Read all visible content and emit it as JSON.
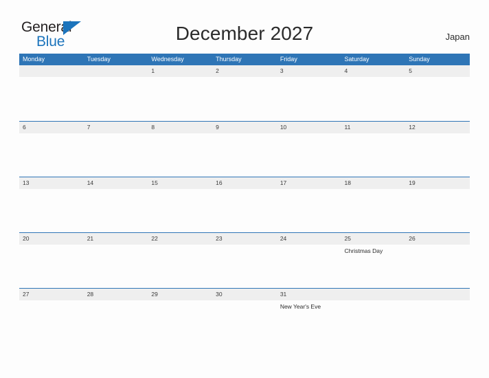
{
  "brand": {
    "name_part1": "General",
    "name_part2": "Blue",
    "flag_color": "#1c74bc"
  },
  "header": {
    "title": "December 2027",
    "locale": "Japan"
  },
  "calendar": {
    "accent_color": "#2e75b6",
    "band_color": "#efefef",
    "weekdays": [
      "Monday",
      "Tuesday",
      "Wednesday",
      "Thursday",
      "Friday",
      "Saturday",
      "Sunday"
    ],
    "weeks": [
      {
        "days": [
          {
            "num": "",
            "event": ""
          },
          {
            "num": "",
            "event": ""
          },
          {
            "num": "1",
            "event": ""
          },
          {
            "num": "2",
            "event": ""
          },
          {
            "num": "3",
            "event": ""
          },
          {
            "num": "4",
            "event": ""
          },
          {
            "num": "5",
            "event": ""
          }
        ]
      },
      {
        "days": [
          {
            "num": "6",
            "event": ""
          },
          {
            "num": "7",
            "event": ""
          },
          {
            "num": "8",
            "event": ""
          },
          {
            "num": "9",
            "event": ""
          },
          {
            "num": "10",
            "event": ""
          },
          {
            "num": "11",
            "event": ""
          },
          {
            "num": "12",
            "event": ""
          }
        ]
      },
      {
        "days": [
          {
            "num": "13",
            "event": ""
          },
          {
            "num": "14",
            "event": ""
          },
          {
            "num": "15",
            "event": ""
          },
          {
            "num": "16",
            "event": ""
          },
          {
            "num": "17",
            "event": ""
          },
          {
            "num": "18",
            "event": ""
          },
          {
            "num": "19",
            "event": ""
          }
        ]
      },
      {
        "days": [
          {
            "num": "20",
            "event": ""
          },
          {
            "num": "21",
            "event": ""
          },
          {
            "num": "22",
            "event": ""
          },
          {
            "num": "23",
            "event": ""
          },
          {
            "num": "24",
            "event": ""
          },
          {
            "num": "25",
            "event": "Christmas Day"
          },
          {
            "num": "26",
            "event": ""
          }
        ]
      },
      {
        "days": [
          {
            "num": "27",
            "event": ""
          },
          {
            "num": "28",
            "event": ""
          },
          {
            "num": "29",
            "event": ""
          },
          {
            "num": "30",
            "event": ""
          },
          {
            "num": "31",
            "event": "New Year's Eve"
          },
          {
            "num": "",
            "event": ""
          },
          {
            "num": "",
            "event": ""
          }
        ]
      }
    ]
  }
}
